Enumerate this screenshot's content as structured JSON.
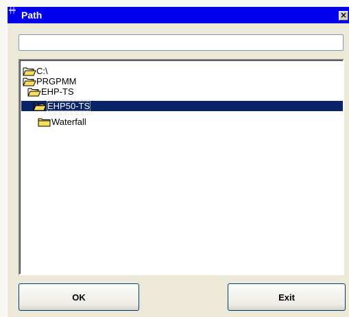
{
  "window": {
    "title": "Path",
    "close_label": "×"
  },
  "path_input": {
    "value": "",
    "placeholder": ""
  },
  "tree": {
    "nodes": [
      {
        "label": "C:\\",
        "state": "open",
        "depth": 0,
        "selected": false
      },
      {
        "label": "PRGPMM",
        "state": "open",
        "depth": 0,
        "selected": false
      },
      {
        "label": "EHP-TS",
        "state": "open",
        "depth": 1,
        "selected": false
      },
      {
        "label": "EHP50-TS",
        "state": "open",
        "depth": 2,
        "selected": true
      },
      {
        "label": "Waterfall",
        "state": "closed",
        "depth": 3,
        "selected": false
      }
    ]
  },
  "buttons": {
    "ok_label": "OK",
    "exit_label": "Exit"
  },
  "colors": {
    "titlebar": "#0000ee",
    "selection": "#0a246a",
    "folder": "#f7de5a"
  }
}
